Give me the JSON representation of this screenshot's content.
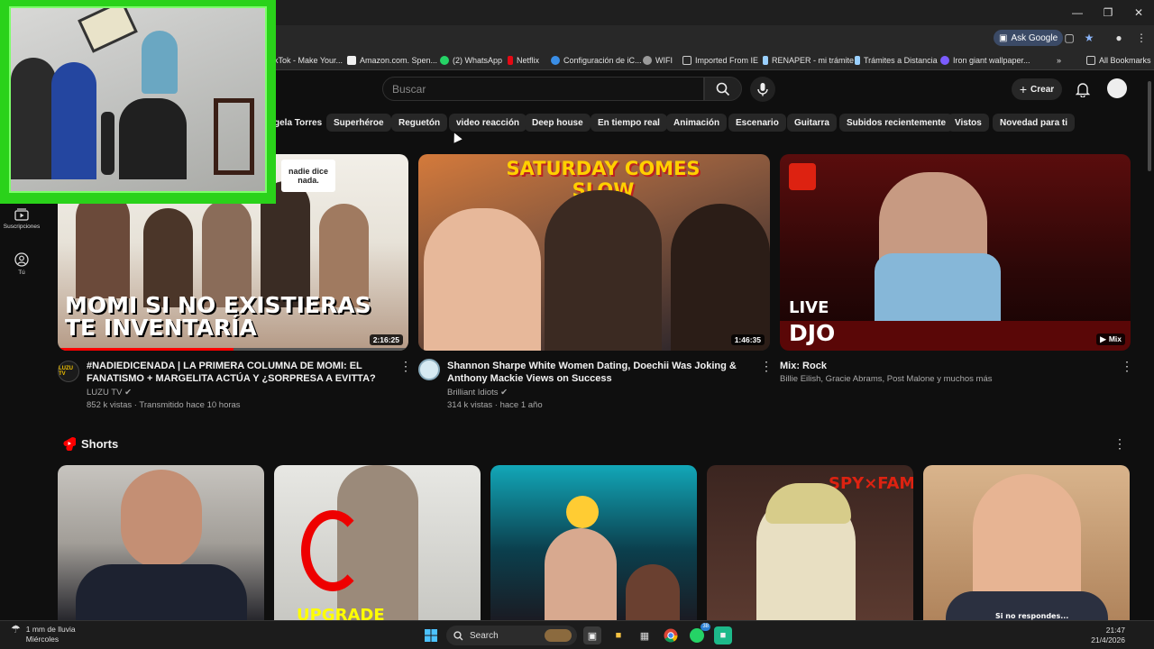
{
  "browser": {
    "ask_google_label": "Ask Google",
    "bookmarks": [
      {
        "label": "kTok - Make Your...",
        "color": "#111111"
      },
      {
        "label": "Amazon.com. Spen...",
        "color": "#f0f0f0"
      },
      {
        "label": "(2) WhatsApp",
        "color": "#25d366"
      },
      {
        "label": "Netflix",
        "color": "#e50914"
      },
      {
        "label": "Configuración de iC...",
        "color": "#3a8ee6"
      },
      {
        "label": "WIFI",
        "color": "#9a9a9a"
      },
      {
        "label": "Imported From IE",
        "color": "#9a9a9a"
      },
      {
        "label": "RENAPER - mi trámite",
        "color": "#9ad0ff"
      },
      {
        "label": "Trámites a Distancia",
        "color": "#9ad0ff"
      },
      {
        "label": "Iron giant wallpaper...",
        "color": "#7b5cff"
      }
    ],
    "all_bookmarks_label": "All Bookmarks"
  },
  "youtube": {
    "search_placeholder": "Buscar",
    "create_label": "Crear",
    "chips": [
      "gela Torres",
      "Superhéroe",
      "Reguetón",
      "video reacción",
      "Deep house",
      "En tiempo real",
      "Animación",
      "Escenario",
      "Guitarra",
      "Subidos recientemente",
      "Vistos",
      "Novedad para ti"
    ],
    "sidebar": [
      {
        "label": "Suscripciones",
        "icon": "subscriptions-icon"
      },
      {
        "label": "Tú",
        "icon": "you-icon"
      }
    ],
    "videos": [
      {
        "title": "#NADIEDICENADA | LA PRIMERA COLUMNA DE MOMI: EL FANATISMO + MARGELITA ACTÚA Y ¿SORPRESA A EVITTA?",
        "channel": "LUZU TV",
        "stats": "852 k vistas · Transmitido hace 10 horas",
        "duration": "2:16:25",
        "thumb_text": "MOMI SI NO EXISTIERAS TE INVENTARÍA",
        "thumb_logo": "nadie dice nada.",
        "thumb_channel_logo": "LUZU TV",
        "watched_progress": 0.5
      },
      {
        "title": "Shannon Sharpe White Women Dating, Doechii Was Joking & Anthony Mackie Views on Success",
        "channel": "Brilliant Idiots",
        "stats": "314 k vistas · hace 1 año",
        "duration": "1:46:35",
        "thumb_text": "SATURDAY COMES SLOW"
      },
      {
        "title": "Mix: Rock",
        "subtitle": "Billie Eilish, Gracie Abrams, Post Malone y muchos más",
        "thumb_live": "LIVE",
        "thumb_text": "DJO",
        "mix_label": "Mix"
      }
    ],
    "shorts_label": "Shorts",
    "shorts_thumbs": [
      {
        "caption": ""
      },
      {
        "caption": "UPGRADE"
      },
      {
        "caption": ""
      },
      {
        "caption": "SPY×FAMILY"
      },
      {
        "caption": "Si no respondes..."
      }
    ]
  },
  "taskbar": {
    "weather_line1": "1 mm de lluvia",
    "weather_line2": "Miércoles",
    "search_label": "Search",
    "whatsapp_badge": "38",
    "time": "21:47",
    "date": "21/4/2026"
  }
}
